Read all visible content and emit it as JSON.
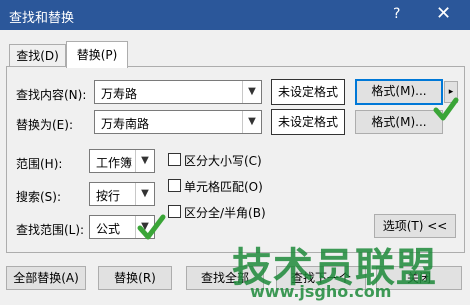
{
  "window": {
    "title": "查找和替换",
    "help": "?",
    "close": "✕"
  },
  "tabs": [
    {
      "label": "查找(D)"
    },
    {
      "label": "替换(P)"
    }
  ],
  "find": {
    "label": "查找内容(N):",
    "value": "万寿路",
    "format_status": "未设定格式",
    "format_button": "格式(M)...",
    "menu_arrow": "▸"
  },
  "replace": {
    "label": "替换为(E):",
    "value": "万寿南路",
    "format_status": "未设定格式",
    "format_button": "格式(M)..."
  },
  "options": {
    "scope_label": "范围(H):",
    "scope_value": "工作簿",
    "search_label": "搜索(S):",
    "search_value": "按行",
    "lookin_label": "查找范围(L):",
    "lookin_value": "公式",
    "match_case": "区分大小写(C)",
    "match_cell": "单元格匹配(O)",
    "match_width": "区分全/半角(B)",
    "options_button": "选项(T) <<"
  },
  "buttons": {
    "replace_all": "全部替换(A)",
    "replace": "替换(R)",
    "find_all": "查找全部",
    "find_next": "查找下一个",
    "close": "关闭"
  },
  "watermark": {
    "brand": "技术员联盟",
    "url": "www.jsgho.com"
  },
  "colors": {
    "titlebar": "#2b579a",
    "check_green": "#3aa537"
  }
}
